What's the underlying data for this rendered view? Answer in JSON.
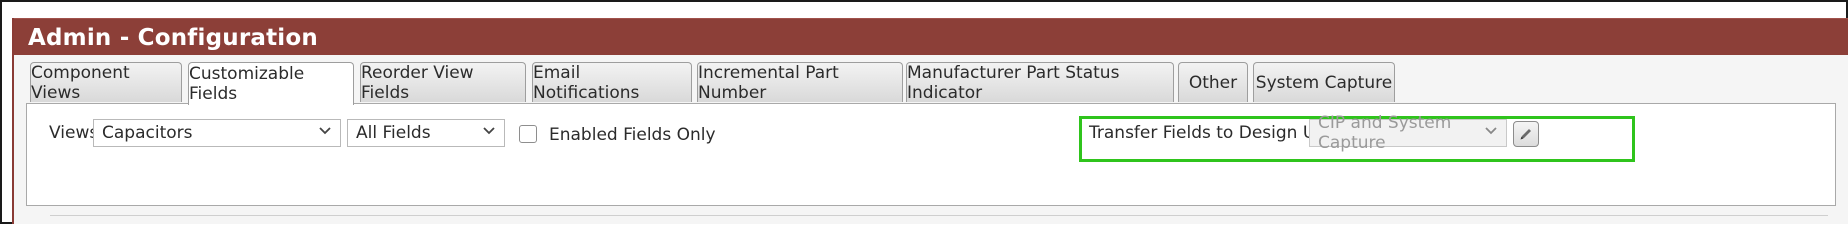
{
  "header": {
    "title": "Admin - Configuration"
  },
  "tabs": [
    {
      "label": "Component Views",
      "active": false
    },
    {
      "label": "Customizable Fields",
      "active": true
    },
    {
      "label": "Reorder View Fields",
      "active": false
    },
    {
      "label": "Email Notifications",
      "active": false
    },
    {
      "label": "Incremental Part Number",
      "active": false
    },
    {
      "label": "Manufacturer Part Status Indicator",
      "active": false
    },
    {
      "label": "Other",
      "active": false
    },
    {
      "label": "System Capture",
      "active": false
    }
  ],
  "filters": {
    "views_label": "Views",
    "views_value": "Capacitors",
    "fields_value": "All Fields",
    "enabled_only_label": "Enabled Fields Only",
    "enabled_only_checked": false
  },
  "transfer": {
    "label": "Transfer Fields to Design Using:",
    "value": "CIP and System Capture",
    "edit_icon": "pencil-icon"
  },
  "colors": {
    "header_bg": "#8c3f38",
    "highlight": "#2fc41c"
  }
}
